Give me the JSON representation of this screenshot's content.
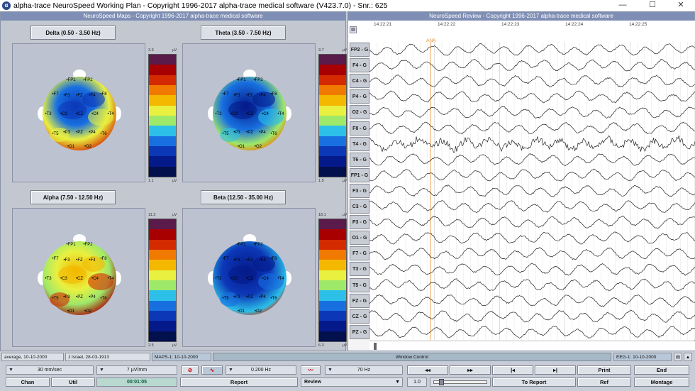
{
  "window": {
    "title": "alpha-trace NeuroSpeed Working Plan - Copyright 1996-2017 alpha-trace medical software (V423.7.0) - Snr.: 625",
    "min": "—",
    "max": "☐",
    "close": "✕"
  },
  "maps_panel": {
    "title": "NeuroSpeed Maps - Copyright 1996-2017 alpha-trace medical software",
    "bands": [
      {
        "label": "Delta (0.50 - 3.50 Hz)",
        "max": "3.3",
        "min": "1.1",
        "unit": "µV"
      },
      {
        "label": "Theta (3.50 - 7.50 Hz)",
        "max": "3.7",
        "min": "1.5",
        "unit": "µV"
      },
      {
        "label": "Alpha (7.50 - 12.50 Hz)",
        "max": "11.3",
        "min": "2.5",
        "unit": "µV"
      },
      {
        "label": "Beta (12.50 - 35.00 Hz)",
        "max": "18.1",
        "min": "6.3",
        "unit": "µV"
      }
    ],
    "electrodes": [
      "FP1",
      "FP2",
      "F7",
      "F3",
      "FZ",
      "F4",
      "F8",
      "T3",
      "C3",
      "CZ",
      "C4",
      "T4",
      "T5",
      "P3",
      "PZ",
      "P4",
      "T6",
      "O1",
      "O2"
    ],
    "scale_colors": [
      "#5a1a4a",
      "#a80000",
      "#d42a00",
      "#f07a00",
      "#f4b800",
      "#e8f040",
      "#9ee86a",
      "#2cc0e8",
      "#1870e0",
      "#0c38b8",
      "#051a8a",
      "#02104e"
    ]
  },
  "review_panel": {
    "title": "NeuroSpeed Review - Copyright 1996-2017 alpha-trace medical software",
    "times": [
      "14:22:21",
      "14:22:22",
      "14:22:23",
      "14:22:24",
      "14:22:25"
    ],
    "marker": "ANA",
    "channels": [
      "FP2 - G",
      "F4 - G",
      "C4 - G",
      "P4 - G",
      "O2 - G",
      "F8 - G",
      "T4 - G",
      "T6 - G",
      "FP1 - G",
      "F3 - G",
      "C3 - G",
      "P3 - G",
      "O1 - G",
      "F7 - G",
      "T3 - G",
      "T5 - G",
      "FZ - G",
      "CZ - G",
      "PZ - G"
    ]
  },
  "status": {
    "montage": "average, 10-10-2000",
    "patient": "J Israel, 28-03-1913",
    "maps": "MAPS-1: 10-10-2000",
    "window_control": "Window Control",
    "eeg": "EEG-1: 10-10-2000"
  },
  "controls": {
    "speed": "30 mm/sec",
    "sensitivity": "7 µV/mm",
    "lowcut": "0.200 Hz",
    "highcut": "70 Hz",
    "time": "00:01:05",
    "ratio": "1.0",
    "buttons": {
      "chan": "Chan",
      "util": "Util",
      "report": "Report",
      "review": "Review",
      "to_report": "To Report",
      "ref": "Ref",
      "montage": "Montage",
      "print": "Print",
      "end": "End",
      "rew": "◂◂",
      "ff": "▸▸",
      "first": "|◂",
      "last": "▸|"
    }
  }
}
